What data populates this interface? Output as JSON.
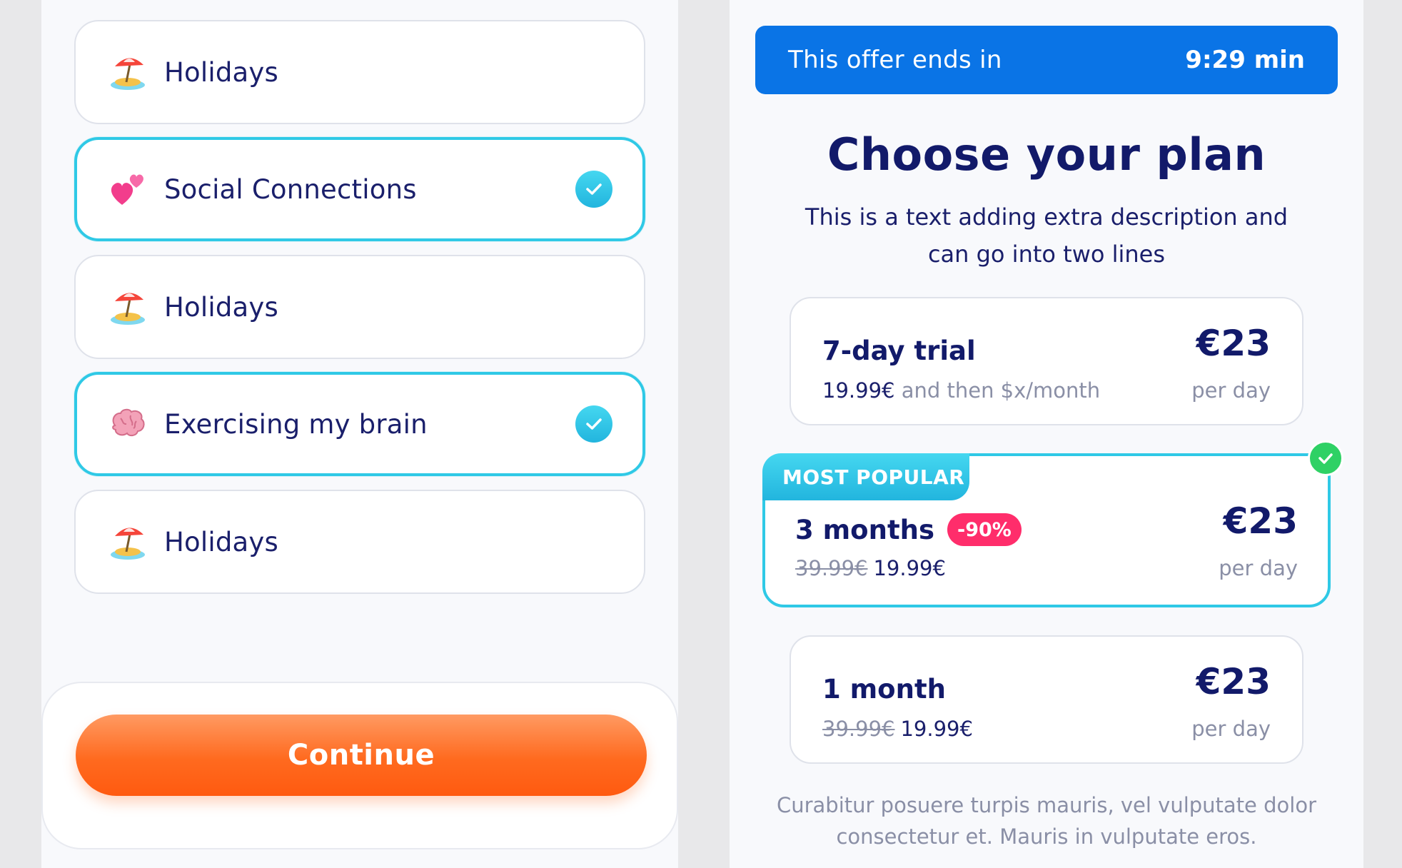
{
  "left": {
    "options": [
      {
        "icon": "beach-umbrella-icon",
        "label": "Holidays",
        "selected": false
      },
      {
        "icon": "two-hearts-icon",
        "label": "Social Connections",
        "selected": true
      },
      {
        "icon": "beach-umbrella-icon",
        "label": "Holidays",
        "selected": false
      },
      {
        "icon": "brain-icon",
        "label": "Exercising my brain",
        "selected": true
      },
      {
        "icon": "beach-umbrella-icon",
        "label": "Holidays",
        "selected": false
      }
    ],
    "continue_label": "Continue"
  },
  "right": {
    "timer": {
      "label": "This offer ends in",
      "value": "9:29 min"
    },
    "title": "Choose your plan",
    "description": "This is a text adding extra description and can go into two lines",
    "plans": [
      {
        "name": "7-day trial",
        "price_main": "19.99€",
        "price_note": " and then $x/month",
        "price": "€23",
        "per": "per day",
        "selected": false
      },
      {
        "tag": "MOST POPULAR",
        "name": "3 months",
        "discount": "-90%",
        "old_price": "39.99€",
        "new_price": "19.99€",
        "price": "€23",
        "per": "per day",
        "selected": true
      },
      {
        "name": "1 month",
        "old_price": "39.99€",
        "new_price": "19.99€",
        "price": "€23",
        "per": "per day",
        "selected": false
      }
    ],
    "disclaimer": "Curabitur posuere turpis mauris, vel vulputate dolor consectetur et. Mauris in vulputate eros."
  },
  "colors": {
    "accent_cyan": "#2fc9e6",
    "timer_blue": "#0a74e6",
    "cta_orange": "#ff6a1f",
    "discount_pink": "#ff2d6b",
    "success_green": "#2fd165",
    "text_navy": "#121a6a"
  }
}
